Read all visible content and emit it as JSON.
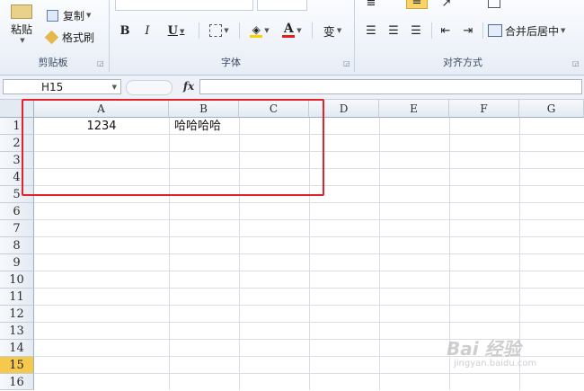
{
  "ribbon": {
    "clipboard": {
      "paste_label": "粘贴",
      "copy_label": "复制",
      "format_painter_label": "格式刷",
      "group_label": "剪贴板"
    },
    "font": {
      "bold_label": "B",
      "italic_label": "I",
      "underline_label": "U",
      "font_color_label": "A",
      "phonetic_label": "变",
      "group_label": "字体",
      "font_color": "#e02020",
      "fill_color": "#f5d400"
    },
    "alignment": {
      "merge_center_label": "合并后居中",
      "group_label": "对齐方式"
    }
  },
  "formula_bar": {
    "name_box_value": "H15",
    "fx_label": "fx",
    "formula_value": ""
  },
  "grid": {
    "columns": [
      "A",
      "B",
      "C",
      "D",
      "E",
      "F",
      "G"
    ],
    "rows": [
      "1",
      "2",
      "3",
      "4",
      "5",
      "6",
      "7",
      "8",
      "9",
      "10",
      "11",
      "12",
      "13",
      "14",
      "15",
      "16"
    ],
    "active_row": "15",
    "cells": {
      "A1": "1234",
      "B1": "哈哈哈哈"
    }
  },
  "watermark": {
    "brand": "Bai 经验",
    "site": "jingyan.baidu.com"
  },
  "colors": {
    "highlight_box": "#e2232a",
    "active_row_header": "#f5c94c"
  }
}
